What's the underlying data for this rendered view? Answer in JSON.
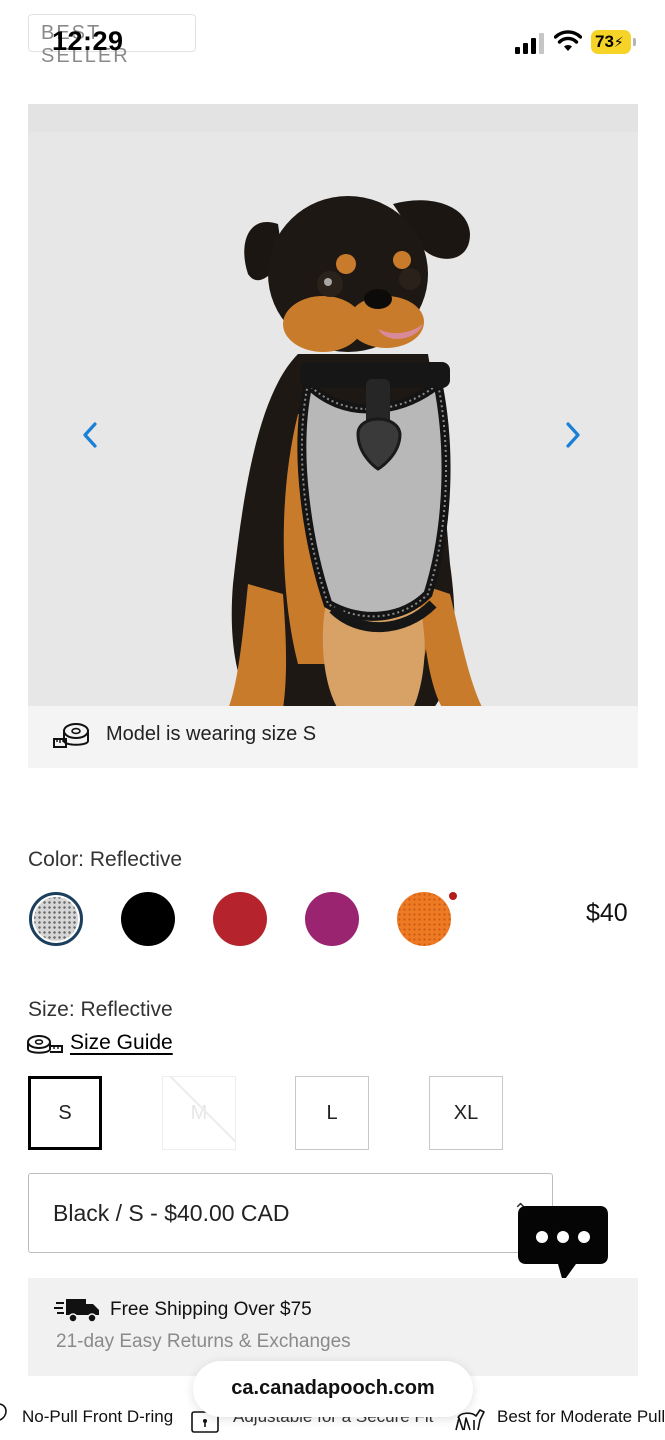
{
  "status_bar": {
    "time": "12:29",
    "battery": "73"
  },
  "badge": "BEST SELLER",
  "gallery": {
    "prev_icon": "chevron-left-icon",
    "next_icon": "chevron-right-icon",
    "image_subject": "dog-wearing-reflective-harness",
    "model_note": "Model is wearing size S"
  },
  "color": {
    "label": "Color: Reflective",
    "selected": "Reflective",
    "swatches": [
      {
        "name": "reflective",
        "hex": "#d6d6d6"
      },
      {
        "name": "black",
        "hex": "#000000"
      },
      {
        "name": "red",
        "hex": "#b5242c"
      },
      {
        "name": "purple",
        "hex": "#9b2470"
      },
      {
        "name": "orange",
        "hex": "#ee7a23"
      }
    ],
    "new_indicator_hex": "#b41c1c"
  },
  "price": "$40",
  "size": {
    "label": "Size: Reflective",
    "guide_label": "Size Guide",
    "options": [
      "S",
      "M",
      "L",
      "XL"
    ],
    "selected": "S",
    "unavailable": [
      "M"
    ]
  },
  "variant": {
    "value": "Black / S - $40.00 CAD"
  },
  "shipping": {
    "title": "Free Shipping Over $75",
    "subtitle": "21-day Easy Returns & Exchanges"
  },
  "browser": {
    "url": "ca.canadapooch.com"
  },
  "features": [
    {
      "label": "No-Pull Front D-ring",
      "icon": "d-ring-icon"
    },
    {
      "label": "Adjustable for a Secure Fit",
      "icon": "lock-icon"
    },
    {
      "label": "Best for Moderate Pull",
      "icon": "walking-dog-icon"
    }
  ]
}
